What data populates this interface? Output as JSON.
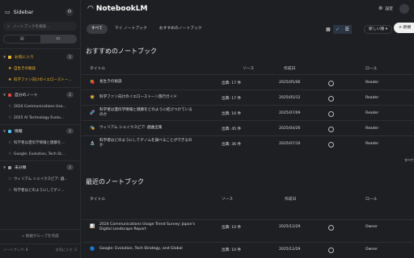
{
  "sidebar": {
    "title": "Sidebar",
    "search_placeholder": "ノートブックを検索...",
    "groups": [
      {
        "label": "お気に入り",
        "count": "2",
        "color": "#f5b829",
        "items": [
          "自生きの秘訣",
          "科学ファン向けのイエローストー..."
        ]
      },
      {
        "label": "自分のノート",
        "count": "2",
        "color": "#e8453c",
        "items": [
          "2024 Communications Usa...",
          "2025 AI Technology Evolu..."
        ]
      },
      {
        "label": "情報",
        "count": "2",
        "color": "#4fc3f7",
        "items": [
          "科学者は遺伝学情報と健康を...",
          "Google: Evolution, Tech St..."
        ]
      },
      {
        "label": "未分類",
        "count": "2",
        "color": "#9e9e9e",
        "items": [
          "ウィリアム シェイクスピア: 戯...",
          "科学者はどのようにしてゲノ..."
        ]
      }
    ],
    "add_group": "+ 新規グループを作成",
    "footer_left": "ノートブック: 8",
    "footer_right": "お気に入り: 2"
  },
  "header": {
    "app_name": "NotebookLM",
    "settings_label": "設定"
  },
  "tabs": [
    "すべて",
    "マイ ノートブック",
    "おすすめのノートブック"
  ],
  "sort_label": "新しい順 ▾",
  "new_label": "+ 新規",
  "featured": {
    "title": "おすすめのノートブック",
    "columns": {
      "title": "タイトル",
      "source": "ソース",
      "created": "作成日",
      "role": "ロール"
    },
    "rows": [
      {
        "emoji": "🍓",
        "title": "長生きの秘訣",
        "source": "出典: 17 件",
        "date": "2025/05/06",
        "role": "Reader"
      },
      {
        "emoji": "🦁",
        "title": "科学ファン向けのイエローストーン旅行ガイド",
        "source": "出典: 17 件",
        "date": "2025/05/12",
        "role": "Reader"
      },
      {
        "emoji": "🧬",
        "title": "科学者は遺伝学情報と健康をどのように結びつけているのか",
        "source": "出典: 16 件",
        "date": "2025/07/09",
        "role": "Reader"
      },
      {
        "emoji": "🎭",
        "title": "ウィリアム シェイクスピア: 戯曲全集",
        "source": "出典: 45 件",
        "date": "2025/04/26",
        "role": "Reader"
      },
      {
        "emoji": "🔬",
        "title": "科学者はどのようにしてゲノムを調べることができるのか",
        "source": "出典: 36 件",
        "date": "2025/07/10",
        "role": "Reader"
      }
    ],
    "see_all": "すべて"
  },
  "recent": {
    "title": "最近のノートブック",
    "columns": {
      "title": "タイトル",
      "source": "ソース",
      "created": "作成日",
      "role": "ロール"
    },
    "rows": [
      {
        "emoji": "📊",
        "title": "2024 Communications Usage Trend Survey: Japan's Digital Landscape Report",
        "source": "出典: 10 件",
        "date": "2025/12/29",
        "role": "Owner"
      },
      {
        "emoji": "🔵",
        "title": "Google: Evolution, Tech Strategy, and Global",
        "source": "出典: 10 件",
        "date": "2025/12/29",
        "role": "Owner"
      }
    ]
  }
}
